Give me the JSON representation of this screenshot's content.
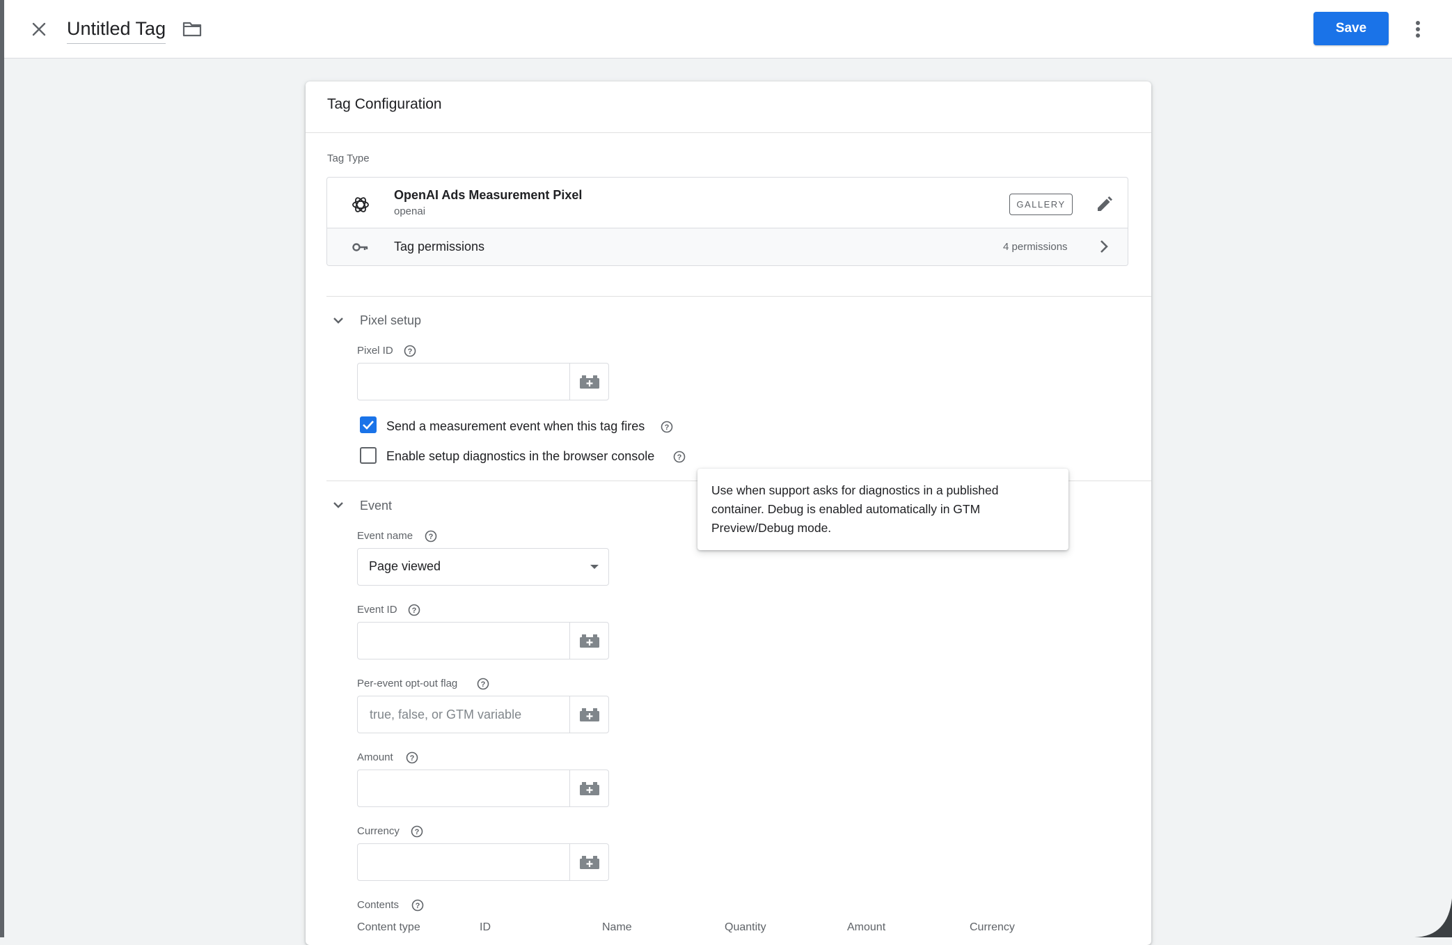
{
  "header": {
    "title": "Untitled Tag",
    "save_label": "Save"
  },
  "card": {
    "title": "Tag Configuration",
    "tag_type_label": "Tag Type",
    "tag_type": {
      "name": "OpenAI Ads Measurement Pixel",
      "vendor": "openai",
      "badge": "GALLERY"
    },
    "permissions": {
      "label": "Tag permissions",
      "count": "4 permissions"
    }
  },
  "pixel_setup": {
    "title": "Pixel setup",
    "pixel_id": {
      "label": "Pixel ID",
      "value": ""
    },
    "send_event": {
      "label": "Send a measurement event when this tag fires",
      "checked": true
    },
    "diagnostics": {
      "label": "Enable setup diagnostics in the browser console",
      "checked": false
    }
  },
  "tooltip": {
    "text": "Use when support asks for diagnostics in a published container. Debug is enabled automatically in GTM Preview/Debug mode."
  },
  "event": {
    "title": "Event",
    "event_name": {
      "label": "Event name",
      "value": "Page viewed"
    },
    "event_id": {
      "label": "Event ID",
      "value": ""
    },
    "opt_out": {
      "label": "Per-event opt-out flag",
      "placeholder": "true, false, or GTM variable"
    },
    "amount": {
      "label": "Amount",
      "value": ""
    },
    "currency": {
      "label": "Currency",
      "value": ""
    },
    "contents": {
      "label": "Contents",
      "columns": [
        "Content type",
        "ID",
        "Name",
        "Quantity",
        "Amount",
        "Currency"
      ]
    }
  },
  "colors": {
    "accent": "#1a73e8",
    "background": "#f1f3f4"
  }
}
